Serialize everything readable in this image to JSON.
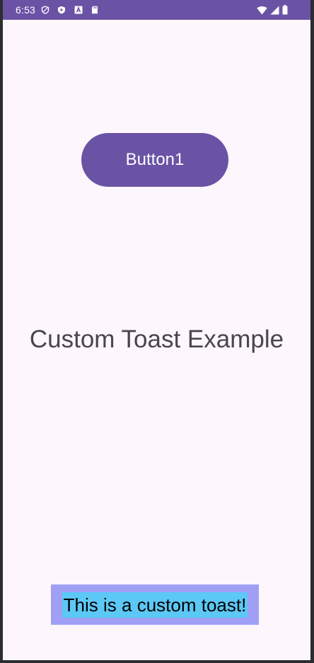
{
  "status_bar": {
    "time": "6:53",
    "left_icons": [
      "shield-icon",
      "play-protect-icon",
      "text-a-icon",
      "sd-card-icon"
    ],
    "right_icons": [
      "wifi-icon",
      "signal-icon",
      "battery-icon"
    ],
    "color": "#6a53a5"
  },
  "main": {
    "button1_label": "Button1",
    "title": "Custom Toast Example"
  },
  "toast": {
    "message": "This is a custom toast!",
    "background": "#9fa0f5",
    "text_background": "#5cc8f5"
  }
}
